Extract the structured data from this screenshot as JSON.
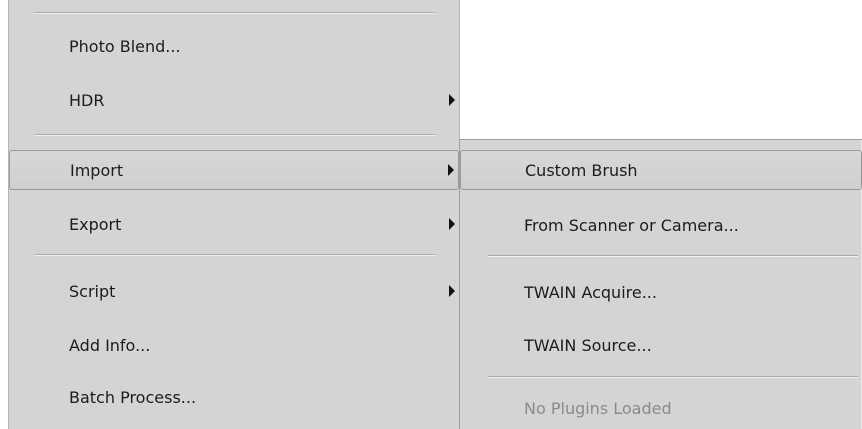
{
  "main_menu": {
    "items": [
      {
        "label": "Photo Blend..."
      },
      {
        "label": "HDR"
      },
      {
        "label": "Import"
      },
      {
        "label": "Export"
      },
      {
        "label": "Script"
      },
      {
        "label": "Add Info..."
      },
      {
        "label": "Batch Process..."
      }
    ]
  },
  "import_submenu": {
    "items": [
      {
        "label": "Custom Brush"
      },
      {
        "label": "From Scanner or Camera..."
      },
      {
        "label": "TWAIN Acquire..."
      },
      {
        "label": "TWAIN Source..."
      },
      {
        "label": "No Plugins Loaded"
      }
    ]
  }
}
